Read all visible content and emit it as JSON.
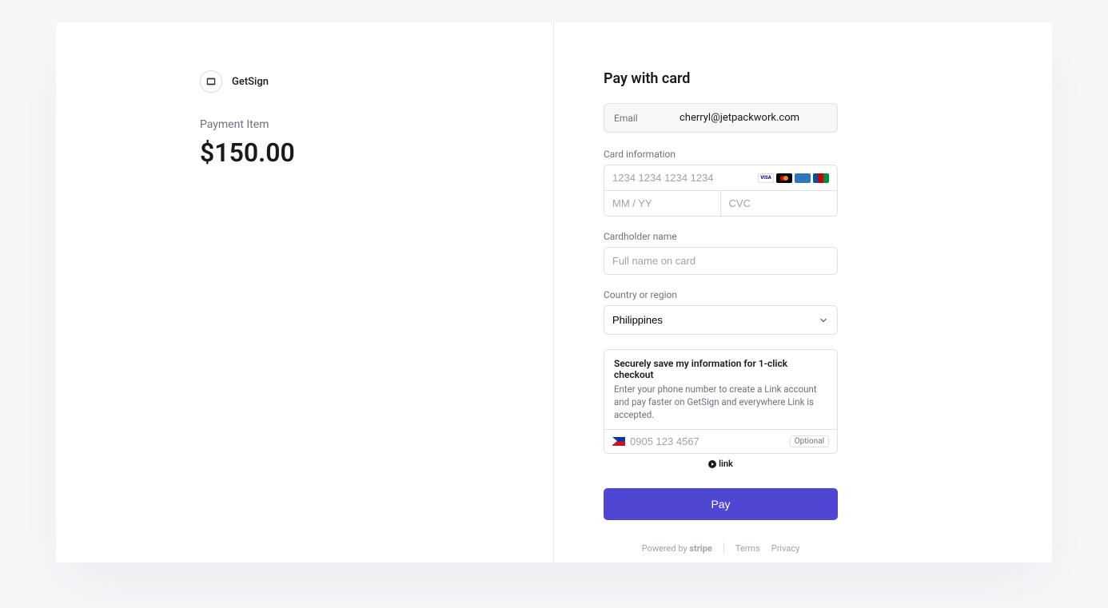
{
  "merchant": {
    "name": "GetSign"
  },
  "payment": {
    "item_label": "Payment Item",
    "amount": "$150.00"
  },
  "form": {
    "heading": "Pay with card",
    "email_label": "Email",
    "email_value": "cherryl@jetpackwork.com",
    "card_info_label": "Card information",
    "card_number_placeholder": "1234 1234 1234 1234",
    "expiry_placeholder": "MM / YY",
    "cvc_placeholder": "CVC",
    "cardholder_label": "Cardholder name",
    "cardholder_placeholder": "Full name on card",
    "country_label": "Country or region",
    "country_value": "Philippines",
    "link_title": "Securely save my information for 1-click checkout",
    "link_desc": "Enter your phone number to create a Link account and pay faster on GetSign and everywhere Link is accepted.",
    "phone_placeholder": "0905 123 4567",
    "optional_label": "Optional",
    "link_brand": "link",
    "pay_button": "Pay"
  },
  "footer": {
    "powered_by": "Powered by",
    "stripe": "stripe",
    "terms": "Terms",
    "privacy": "Privacy"
  }
}
